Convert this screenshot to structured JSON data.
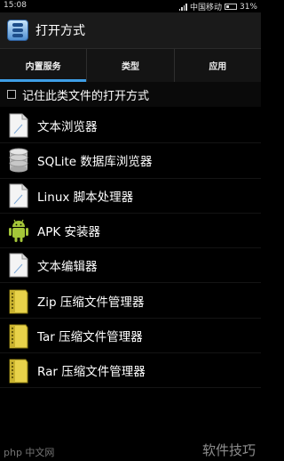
{
  "status_bar": {
    "time": "15:08",
    "carrier": "中国移动",
    "battery": "31%"
  },
  "title_bar": {
    "title": "打开方式",
    "icon": "app-icon"
  },
  "tabs": [
    {
      "label": "内置服务",
      "active": true
    },
    {
      "label": "类型",
      "active": false
    },
    {
      "label": "应用",
      "active": false
    }
  ],
  "remember_option": {
    "label": "记住此类文件的打开方式",
    "checked": false
  },
  "items": [
    {
      "label": "文本浏览器",
      "icon": "document-icon"
    },
    {
      "label": "SQLite 数据库浏览器",
      "icon": "database-icon"
    },
    {
      "label": "Linux 脚本处理器",
      "icon": "document-icon"
    },
    {
      "label": "APK 安装器",
      "icon": "android-icon"
    },
    {
      "label": "文本编辑器",
      "icon": "document-icon"
    },
    {
      "label": "Zip 压缩文件管理器",
      "icon": "zip-folder-icon"
    },
    {
      "label": "Tar 压缩文件管理器",
      "icon": "zip-folder-icon"
    },
    {
      "label": "Rar 压缩文件管理器",
      "icon": "zip-folder-icon"
    }
  ],
  "watermark": {
    "text": "软件技巧",
    "sub": "php 中文网"
  },
  "colors": {
    "tab_indicator": "#3e9ee6",
    "android_green": "#a4c639",
    "folder_yellow": "#e8d24a"
  }
}
